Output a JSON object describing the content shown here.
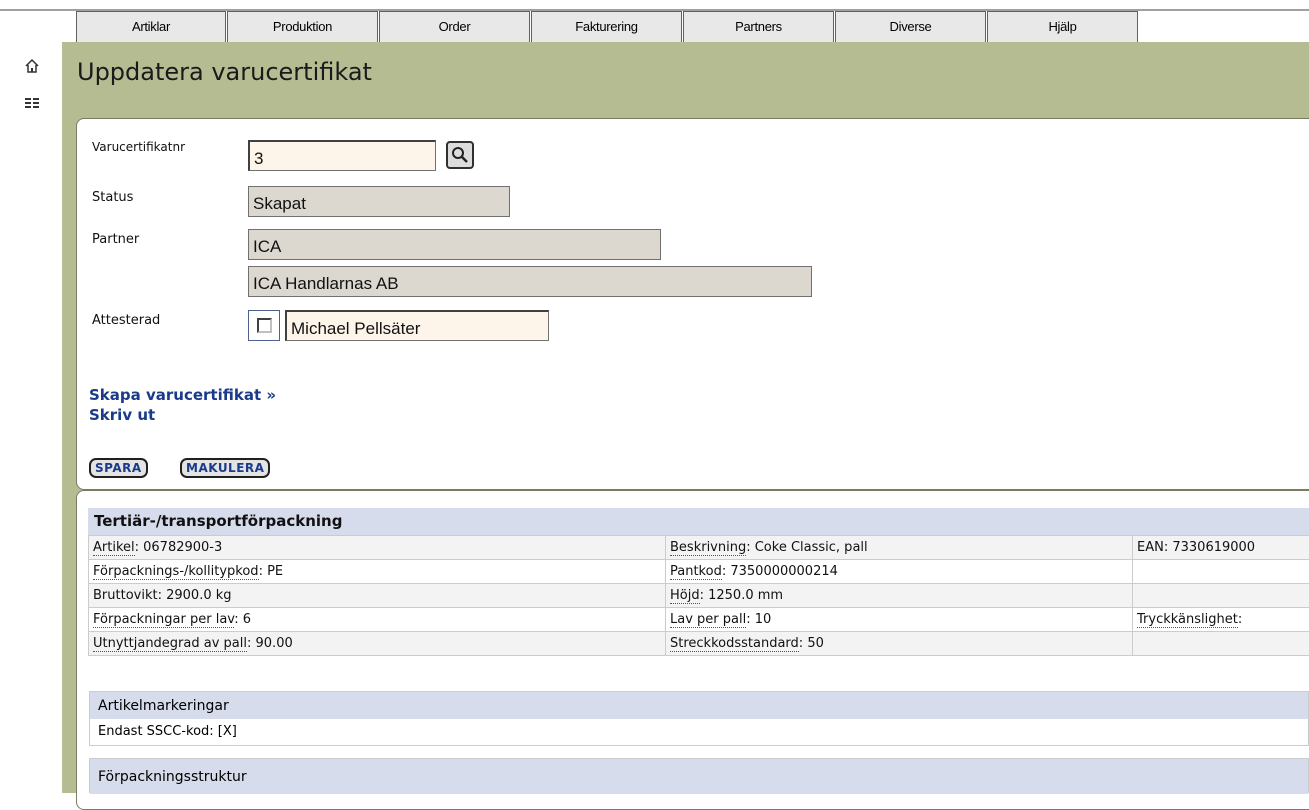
{
  "nav": {
    "tabs": [
      "Artiklar",
      "Produktion",
      "Order",
      "Fakturering",
      "Partners",
      "Diverse",
      "Hjälp"
    ]
  },
  "page": {
    "title": "Uppdatera varucertifikat"
  },
  "form": {
    "cert_label": "Varucertifikatnr",
    "cert_value": "3",
    "status_label": "Status",
    "status_value": "Skapat",
    "partner_label": "Partner",
    "partner_code": "ICA",
    "partner_name": "ICA Handlarnas AB",
    "attest_label": "Attesterad",
    "attest_checked": false,
    "attest_person": "Michael Pellsäter"
  },
  "links": {
    "create": "Skapa varucertifikat »",
    "print": "Skriv ut"
  },
  "buttons": {
    "save": "SPARA",
    "cancel": "MAKULERA"
  },
  "section": {
    "title": "Tertiär-/transportförpackning",
    "rows": [
      [
        {
          "label": "Artikel",
          "value": "06782900-3"
        },
        {
          "label": "Beskrivning",
          "value": "Coke Classic, pall"
        },
        {
          "label": "EAN",
          "value": "7330619000"
        }
      ],
      [
        {
          "label": "Förpacknings-/kollitypkod",
          "value": "PE"
        },
        {
          "label": "Pantkod",
          "value": "7350000000214"
        },
        {
          "label": "",
          "value": ""
        }
      ],
      [
        {
          "label": "Bruttovikt",
          "value": "2900.0 kg"
        },
        {
          "label": "Höjd",
          "value": "1250.0 mm"
        },
        {
          "label": "",
          "value": ""
        }
      ],
      [
        {
          "label": "Förpackningar per lav",
          "value": "6"
        },
        {
          "label": "Lav per pall",
          "value": "10"
        },
        {
          "label": "Tryckkänslighet",
          "value": ""
        }
      ],
      [
        {
          "label": "Utnyttjandegrad av pall",
          "value": "90.00"
        },
        {
          "label": "Streckkodsstandard",
          "value": "50"
        },
        {
          "label": "",
          "value": ""
        }
      ]
    ],
    "markings": {
      "title": "Artikelmarkeringar",
      "value": "Endast SSCC-kod: [X]"
    },
    "structure": {
      "title": "Förpackningsstruktur"
    }
  },
  "icons": {
    "home": "home-icon",
    "menu": "menu-grid-icon",
    "search": "search-icon"
  },
  "colors": {
    "frame": "#b5bc92",
    "section_header": "#d6dceb",
    "link": "#1a3a8a"
  }
}
